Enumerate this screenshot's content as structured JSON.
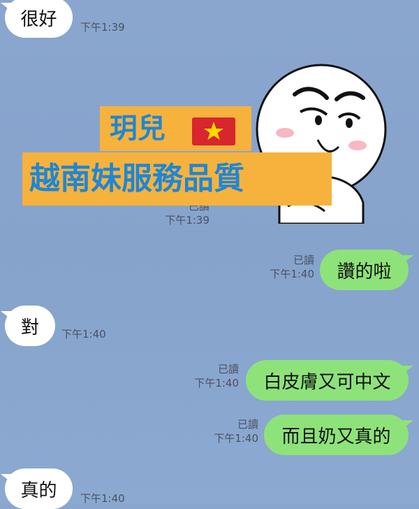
{
  "messages": [
    {
      "side": "in",
      "text": "很好",
      "time": "下午1:39"
    },
    {
      "side": "in",
      "text": "",
      "time": "下午1:39",
      "read": "已讀",
      "sticker": "smug-face-sticker"
    },
    {
      "side": "out",
      "text": "讚的啦",
      "time": "下午1:40",
      "read": "已讀"
    },
    {
      "side": "in",
      "text": "對",
      "time": "下午1:40"
    },
    {
      "side": "out",
      "text": "白皮膚又可中文",
      "time": "下午1:40",
      "read": "已讀"
    },
    {
      "side": "out",
      "text": "而且奶又真的",
      "time": "下午1:40",
      "read": "已讀"
    },
    {
      "side": "in",
      "text": "真的",
      "time": "下午1:40"
    }
  ],
  "overlay": {
    "line1": "玥兒",
    "line2": "越南妹服務品質",
    "flag_icon": "vietnam-flag-icon"
  },
  "colors": {
    "background": "#8aa6cf",
    "incoming_bubble": "#ffffff",
    "outgoing_bubble": "#8ee27a",
    "banner": "#f6b23c",
    "banner_text": "#1f86d6"
  }
}
